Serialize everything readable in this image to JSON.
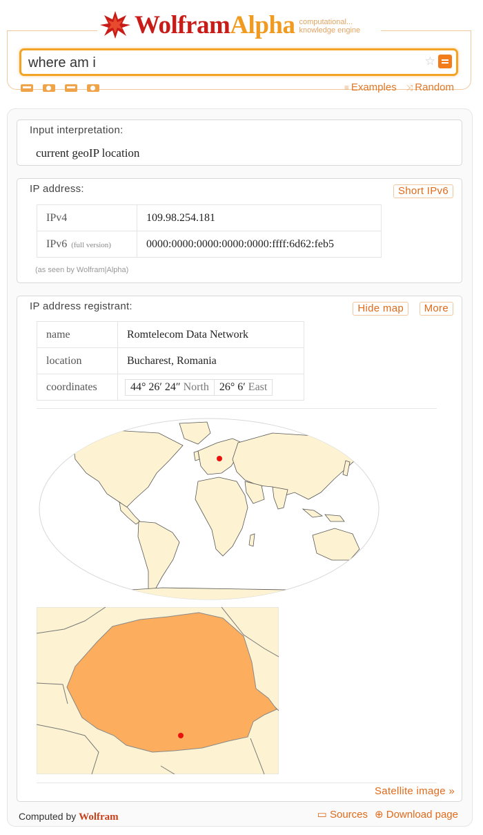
{
  "header": {
    "logo_wolfram": "Wolfram",
    "logo_alpha": "Alpha",
    "tagline_line1": "computational...",
    "tagline_line2": "knowledge engine",
    "links": {
      "examples": "Examples",
      "random": "Random"
    }
  },
  "search": {
    "query": "where am i"
  },
  "pods": {
    "interpretation": {
      "title": "Input interpretation:",
      "text": "current geoIP location"
    },
    "ip_address": {
      "title": "IP address:",
      "button": "Short IPv6",
      "rows": [
        {
          "label": "IPv4",
          "note": "",
          "value": "109.98.254.181"
        },
        {
          "label": "IPv6",
          "note": "(full version)",
          "value": "0000:0000:0000:0000:0000:ffff:6d62:feb5"
        }
      ],
      "note": "(as seen by Wolfram|Alpha)"
    },
    "registrant": {
      "title": "IP address registrant:",
      "buttons": {
        "hide_map": "Hide map",
        "more": "More"
      },
      "rows": [
        {
          "label": "name",
          "value": "Romtelecom Data Network"
        },
        {
          "label": "location",
          "value": "Bucharest, Romania"
        }
      ],
      "coordinates": {
        "label": "coordinates",
        "lat": "44° 26′ 24″",
        "lat_dir": "North",
        "lon": "26° 6′",
        "lon_dir": "East"
      },
      "satellite_link": "Satellite image »"
    }
  },
  "footer": {
    "computed_by": "Computed by",
    "brand": "Wolfram",
    "links": {
      "sources": "Sources",
      "download": "Download page"
    }
  },
  "colors": {
    "accent": "#e06a1a",
    "search_border": "#f4a425",
    "land": "#fdf3d2",
    "romania": "#fcae5e",
    "marker": "#e8120c"
  }
}
